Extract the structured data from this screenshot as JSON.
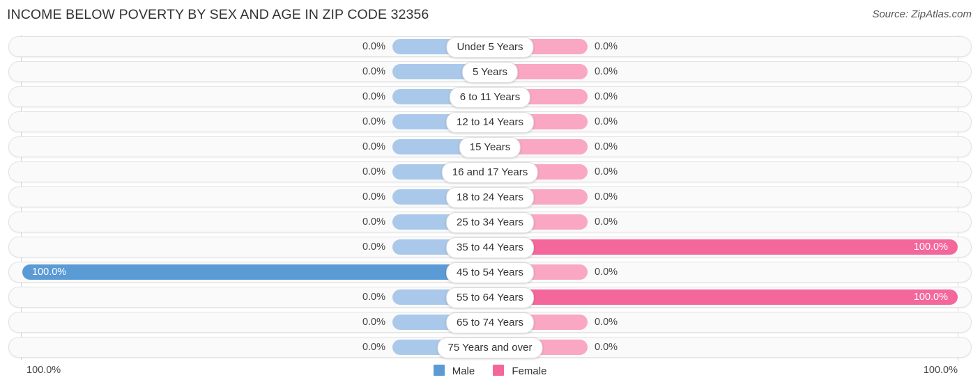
{
  "header": {
    "title": "INCOME BELOW POVERTY BY SEX AND AGE IN ZIP CODE 32356",
    "source": "Source: ZipAtlas.com"
  },
  "legend": {
    "male_label": "Male",
    "female_label": "Female",
    "male_color": "#5b9bd5",
    "female_color": "#f4679a",
    "male_light_color": "#aac9ea",
    "female_light_color": "#f9a7c3"
  },
  "axis": {
    "left_tick": "100.0%",
    "right_tick": "100.0%",
    "max_percent": 100
  },
  "chart_data": {
    "type": "bar",
    "orientation": "horizontal",
    "style": "diverging-population-pyramid",
    "title": "INCOME BELOW POVERTY BY SEX AND AGE IN ZIP CODE 32356",
    "xlabel": "",
    "ylabel": "",
    "xlim": [
      -100,
      100
    ],
    "grid": false,
    "legend_position": "bottom-center",
    "categories": [
      "Under 5 Years",
      "5 Years",
      "6 to 11 Years",
      "12 to 14 Years",
      "15 Years",
      "16 and 17 Years",
      "18 to 24 Years",
      "25 to 34 Years",
      "35 to 44 Years",
      "45 to 54 Years",
      "55 to 64 Years",
      "65 to 74 Years",
      "75 Years and over"
    ],
    "series": [
      {
        "name": "Male",
        "side": "left",
        "color": "#5b9bd5",
        "values": [
          0.0,
          0.0,
          0.0,
          0.0,
          0.0,
          0.0,
          0.0,
          0.0,
          0.0,
          100.0,
          0.0,
          0.0,
          0.0
        ]
      },
      {
        "name": "Female",
        "side": "right",
        "color": "#f4679a",
        "values": [
          0.0,
          0.0,
          0.0,
          0.0,
          0.0,
          0.0,
          0.0,
          0.0,
          100.0,
          0.0,
          100.0,
          0.0,
          0.0
        ]
      }
    ]
  },
  "rows": [
    {
      "label": "Under 5 Years",
      "male": 0.0,
      "female": 0.0,
      "male_text": "0.0%",
      "female_text": "0.0%"
    },
    {
      "label": "5 Years",
      "male": 0.0,
      "female": 0.0,
      "male_text": "0.0%",
      "female_text": "0.0%"
    },
    {
      "label": "6 to 11 Years",
      "male": 0.0,
      "female": 0.0,
      "male_text": "0.0%",
      "female_text": "0.0%"
    },
    {
      "label": "12 to 14 Years",
      "male": 0.0,
      "female": 0.0,
      "male_text": "0.0%",
      "female_text": "0.0%"
    },
    {
      "label": "15 Years",
      "male": 0.0,
      "female": 0.0,
      "male_text": "0.0%",
      "female_text": "0.0%"
    },
    {
      "label": "16 and 17 Years",
      "male": 0.0,
      "female": 0.0,
      "male_text": "0.0%",
      "female_text": "0.0%"
    },
    {
      "label": "18 to 24 Years",
      "male": 0.0,
      "female": 0.0,
      "male_text": "0.0%",
      "female_text": "0.0%"
    },
    {
      "label": "25 to 34 Years",
      "male": 0.0,
      "female": 0.0,
      "male_text": "0.0%",
      "female_text": "0.0%"
    },
    {
      "label": "35 to 44 Years",
      "male": 0.0,
      "female": 100.0,
      "male_text": "0.0%",
      "female_text": "100.0%"
    },
    {
      "label": "45 to 54 Years",
      "male": 100.0,
      "female": 0.0,
      "male_text": "100.0%",
      "female_text": "0.0%"
    },
    {
      "label": "55 to 64 Years",
      "male": 0.0,
      "female": 100.0,
      "male_text": "0.0%",
      "female_text": "100.0%"
    },
    {
      "label": "65 to 74 Years",
      "male": 0.0,
      "female": 0.0,
      "male_text": "0.0%",
      "female_text": "0.0%"
    },
    {
      "label": "75 Years and over",
      "male": 0.0,
      "female": 0.0,
      "male_text": "0.0%",
      "female_text": "0.0%"
    }
  ]
}
